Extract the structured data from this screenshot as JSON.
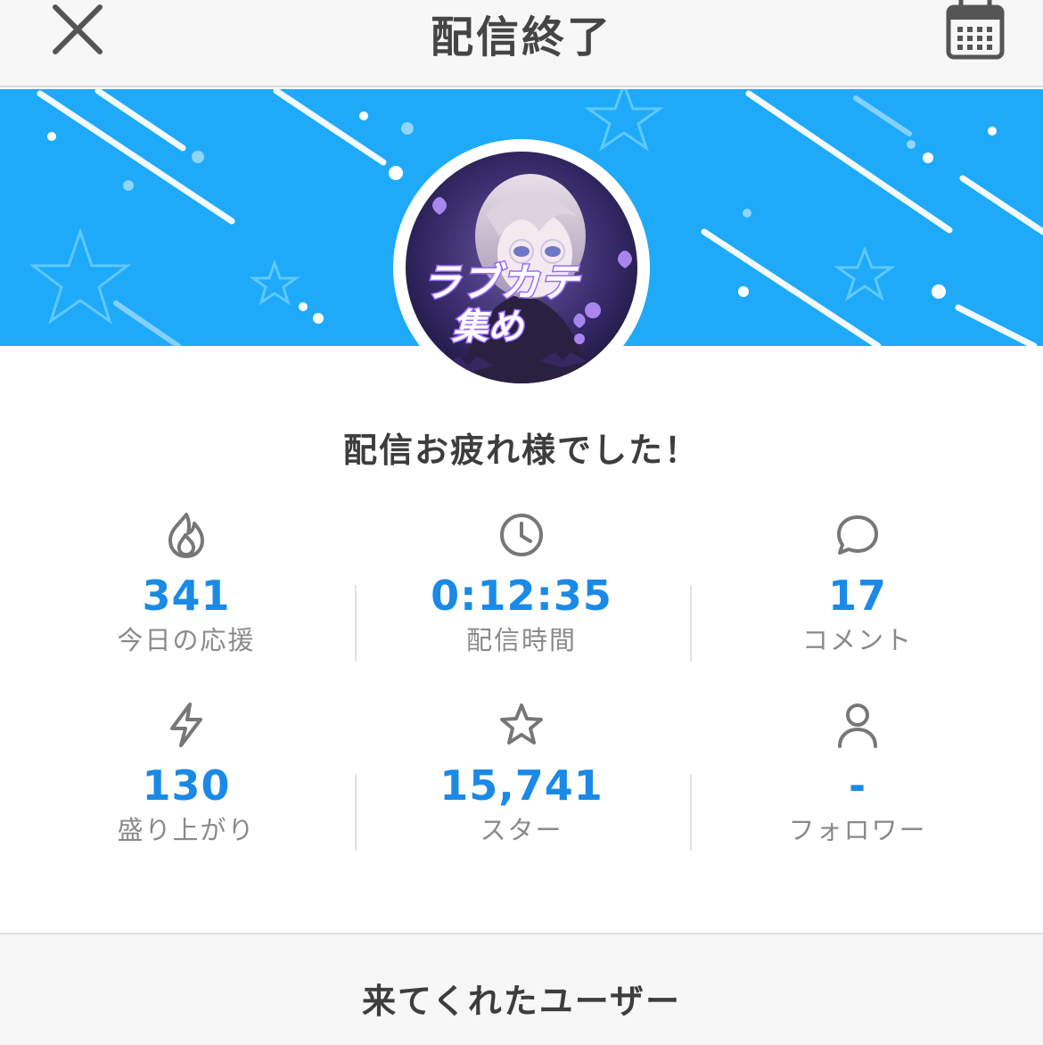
{
  "header": {
    "title": "配信終了",
    "close_icon": "close-icon",
    "calendar_icon": "calendar-icon"
  },
  "banner": {
    "background_color": "#1eaaf8",
    "avatar_text_line1": "ラブカテ",
    "avatar_text_line2": "集め"
  },
  "message": "配信お疲れ様でした！",
  "stats": [
    {
      "icon": "fire-icon",
      "value": "341",
      "label": "今日の応援"
    },
    {
      "icon": "clock-icon",
      "value": "0:12:35",
      "label": "配信時間"
    },
    {
      "icon": "comment-icon",
      "value": "17",
      "label": "コメント"
    },
    {
      "icon": "lightning-icon",
      "value": "130",
      "label": "盛り上がり"
    },
    {
      "icon": "star-icon",
      "value": "15,741",
      "label": "スター"
    },
    {
      "icon": "user-icon",
      "value": "-",
      "label": "フォロワー"
    }
  ],
  "colors": {
    "accent": "#1a8ae6",
    "label": "#8a8a8a"
  },
  "footer": {
    "title": "来てくれたユーザー"
  }
}
